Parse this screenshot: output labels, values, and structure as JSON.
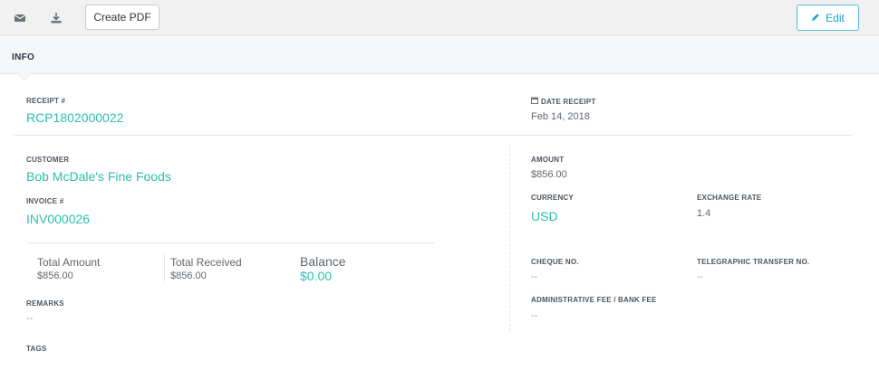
{
  "toolbar": {
    "email_icon": "envelope-icon",
    "download_icon": "download-icon",
    "create_pdf_label": "Create PDF",
    "edit_label": "Edit",
    "edit_icon": "pencil-icon",
    "accent": "#1aa0cf"
  },
  "tabs": {
    "info_label": "INFO"
  },
  "receipt": {
    "number_label": "RECEIPT #",
    "number": "RCP1802000022",
    "date_label": "DATE RECEIPT",
    "date_icon": "calendar-icon",
    "date": "Feb 14, 2018"
  },
  "customer": {
    "label": "CUSTOMER",
    "name": "Bob McDale's Fine Foods",
    "invoice_label": "INVOICE #",
    "invoice": "INV000026"
  },
  "totals": {
    "total_amount_label": "Total Amount",
    "total_amount": "$856.00",
    "total_received_label": "Total Received",
    "total_received": "$856.00",
    "balance_label": "Balance",
    "balance": "$0.00"
  },
  "remarks": {
    "label": "REMARKS",
    "value": "--"
  },
  "tags": {
    "label": "TAGS"
  },
  "payment": {
    "amount_label": "AMOUNT",
    "amount": "$856.00",
    "currency_label": "CURRENCY",
    "currency": "USD",
    "exchange_rate_label": "EXCHANGE RATE",
    "exchange_rate": "1.4",
    "cheque_label": "CHEQUE NO.",
    "cheque": "--",
    "tt_label": "TELEGRAPHIC TRANSFER NO.",
    "tt": "--",
    "fee_label": "ADMINISTRATIVE FEE / BANK FEE",
    "fee": "--"
  },
  "colors": {
    "link_teal": "#2bbfb0",
    "edit_blue": "#1aa0cf"
  }
}
